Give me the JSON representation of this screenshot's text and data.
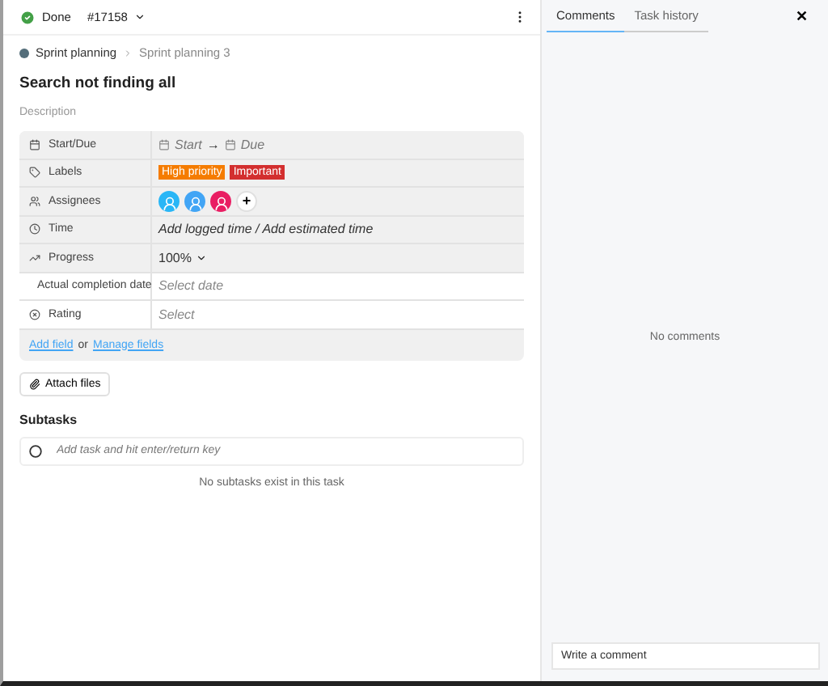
{
  "header": {
    "status": "Done",
    "status_done": true,
    "task_id": "#17158"
  },
  "breadcrumb": {
    "items": [
      "Sprint planning",
      "Sprint planning 3"
    ],
    "color": "#546e7a"
  },
  "title": "Search not finding all",
  "description_placeholder": "Description",
  "fields": [
    {
      "kind": "dates",
      "label": "Start/Due",
      "start": "Start",
      "arrow": "→",
      "due": "Due",
      "filled": true
    },
    {
      "kind": "labels",
      "label": "Labels",
      "tags": [
        {
          "text": "High priority",
          "color": "#f57c00"
        },
        {
          "text": "Important",
          "color": "#d32f2f"
        }
      ],
      "filled": true
    },
    {
      "kind": "assignees",
      "label": "Assignees",
      "avatars": [
        {
          "color": "#29b6f6"
        },
        {
          "color": "#42a5f5"
        },
        {
          "color": "#e91e63"
        }
      ],
      "add": "+",
      "filled": true
    },
    {
      "kind": "text",
      "label": "Time",
      "value": "Add logged time / Add estimated time",
      "filled": true
    },
    {
      "kind": "select",
      "label": "Progress",
      "value": "100%",
      "filled": true
    },
    {
      "kind": "placeholder",
      "label": "Actual completion date",
      "placeholder": "Select date",
      "filled": false
    },
    {
      "kind": "placeholder",
      "label": "Rating",
      "placeholder": "Select",
      "filled": false
    }
  ],
  "field_links": {
    "add": "Add field",
    "or": "or",
    "manage": "Manage fields"
  },
  "attach_button": "Attach files",
  "subtasks": {
    "heading": "Subtasks",
    "placeholder": "Add task and hit enter/return key",
    "empty": "No subtasks exist in this task"
  },
  "side_panel": {
    "tabs": [
      {
        "label": "Comments",
        "selected": true
      },
      {
        "label": "Task history",
        "selected": false
      }
    ],
    "close": "✕",
    "empty": "No comments",
    "comment_placeholder": "Write a comment"
  }
}
